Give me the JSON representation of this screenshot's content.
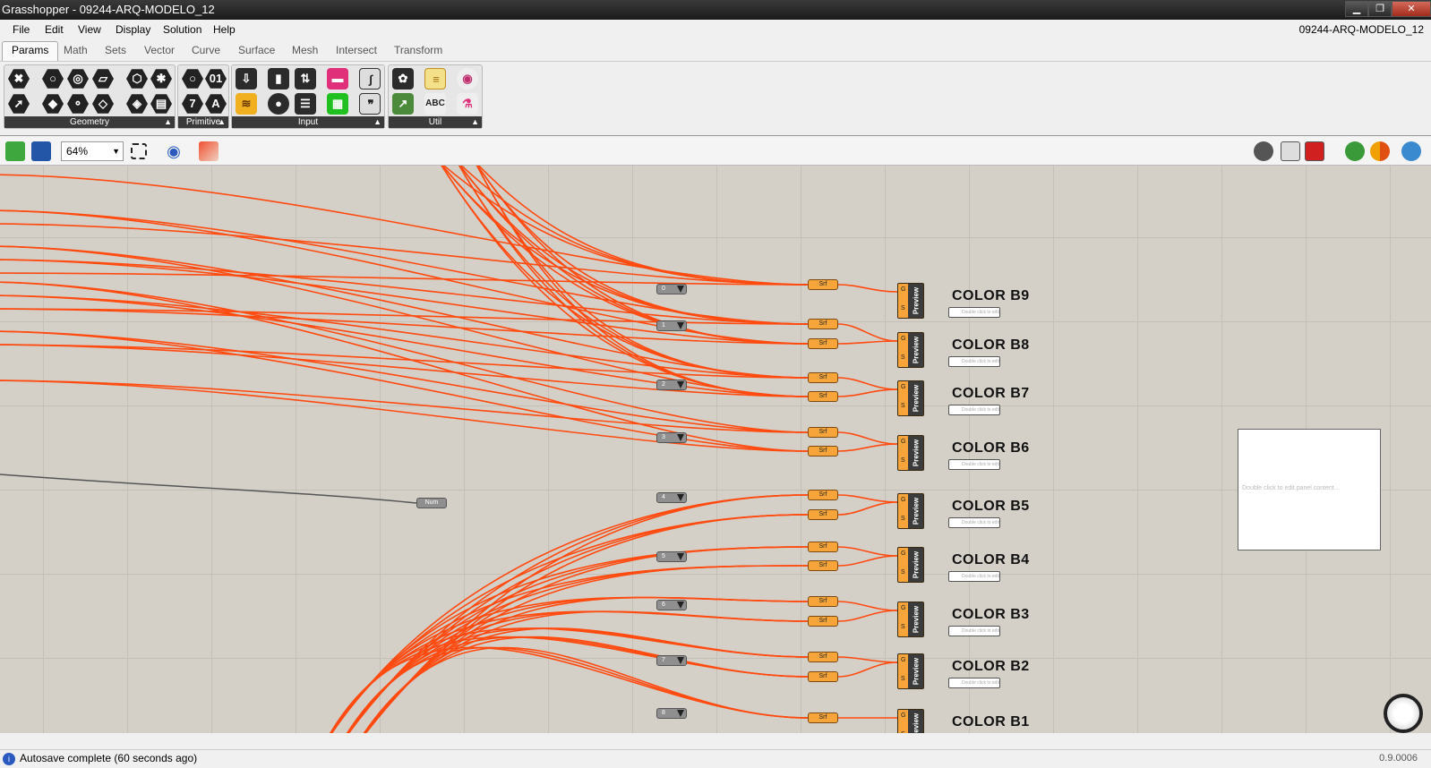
{
  "window": {
    "title": "Grasshopper - 09244-ARQ-MODELO_12",
    "minimize": "▁",
    "maximize": "❐",
    "close": "✕"
  },
  "menu": {
    "items": [
      "File",
      "Edit",
      "View",
      "Display",
      "Solution",
      "Help"
    ],
    "document": "09244-ARQ-MODELO_12"
  },
  "tabs": [
    "Params",
    "Math",
    "Sets",
    "Vector",
    "Curve",
    "Surface",
    "Mesh",
    "Intersect",
    "Transform"
  ],
  "ribbon": {
    "groups": [
      "Geometry",
      "Primitive",
      "Input",
      "Util"
    ]
  },
  "toolbar": {
    "zoom": "64%"
  },
  "canvas": {
    "sliders": [
      "0",
      "1",
      "2",
      "3",
      "4",
      "5",
      "6",
      "7",
      "8"
    ],
    "srf_label": "Srf",
    "preview_label": "Preview",
    "preview_inputs": [
      "G",
      "S"
    ],
    "color_labels": [
      "COLOR B9",
      "COLOR B8",
      "COLOR B7",
      "COLOR B6",
      "COLOR B5",
      "COLOR B4",
      "COLOR B3",
      "COLOR B2",
      "COLOR B1"
    ],
    "mini_panel_text": "Double click to edit",
    "num_label": "Num",
    "panel_text": "Double click to edit panel content…",
    "wire_color": "#ff4a10"
  },
  "status": {
    "message": "Autosave complete (60 seconds ago)",
    "version": "0.9.0006"
  }
}
